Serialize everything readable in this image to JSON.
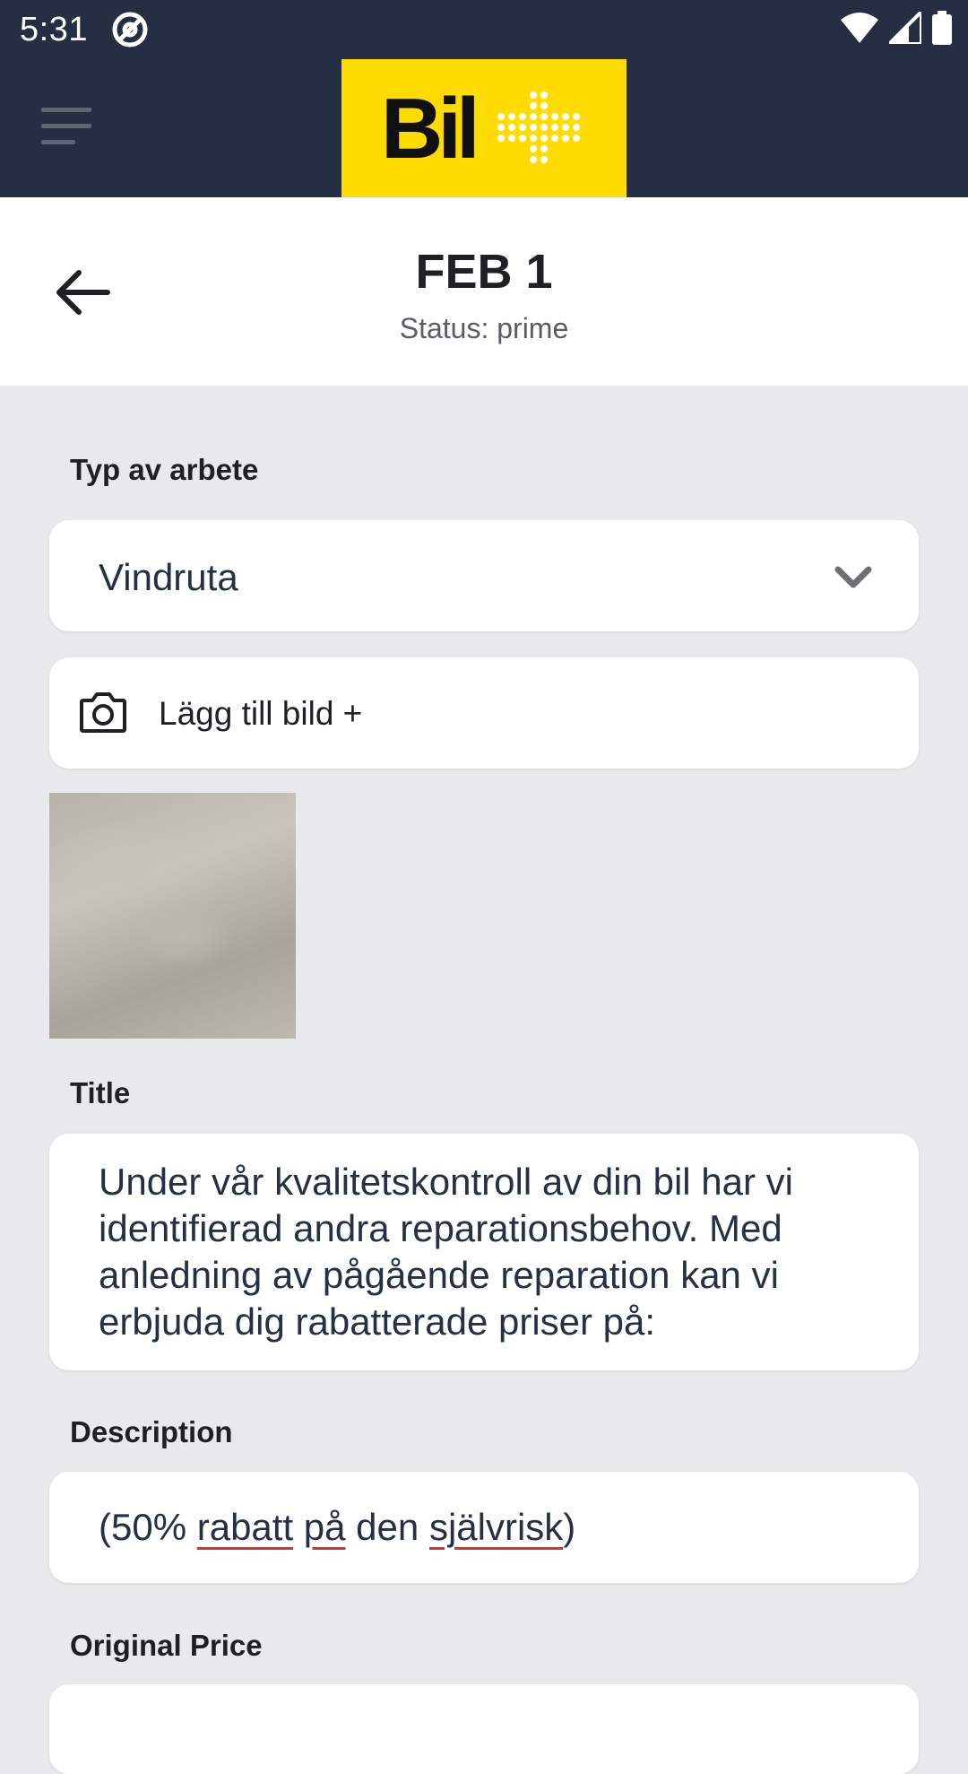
{
  "status_bar": {
    "time": "5:31"
  },
  "app_bar": {
    "logo_text": "Bil",
    "brand_color": "#ffdb00",
    "bar_color": "#252e42"
  },
  "header": {
    "title": "FEB 1",
    "subtitle": "Status: prime"
  },
  "form": {
    "work_type": {
      "label": "Typ av arbete",
      "value": "Vindruta"
    },
    "add_image": {
      "label": "Lägg till bild +"
    },
    "title_field": {
      "label": "Title",
      "value": "Under vår kvalitetskontroll av din bil har vi identifierad andra reparationsbehov. Med anledning av pågående reparation kan vi erbjuda dig rabatterade priser på:"
    },
    "description_field": {
      "label": "Description",
      "parts": [
        "(50% ",
        "rabatt",
        " ",
        "på",
        " den ",
        "självrisk",
        ")"
      ]
    },
    "original_price": {
      "label": "Original Price"
    }
  },
  "icons": {
    "menu": "menu-icon",
    "back": "arrow-left-icon",
    "dropdown": "chevron-down-icon",
    "camera": "camera-icon"
  }
}
